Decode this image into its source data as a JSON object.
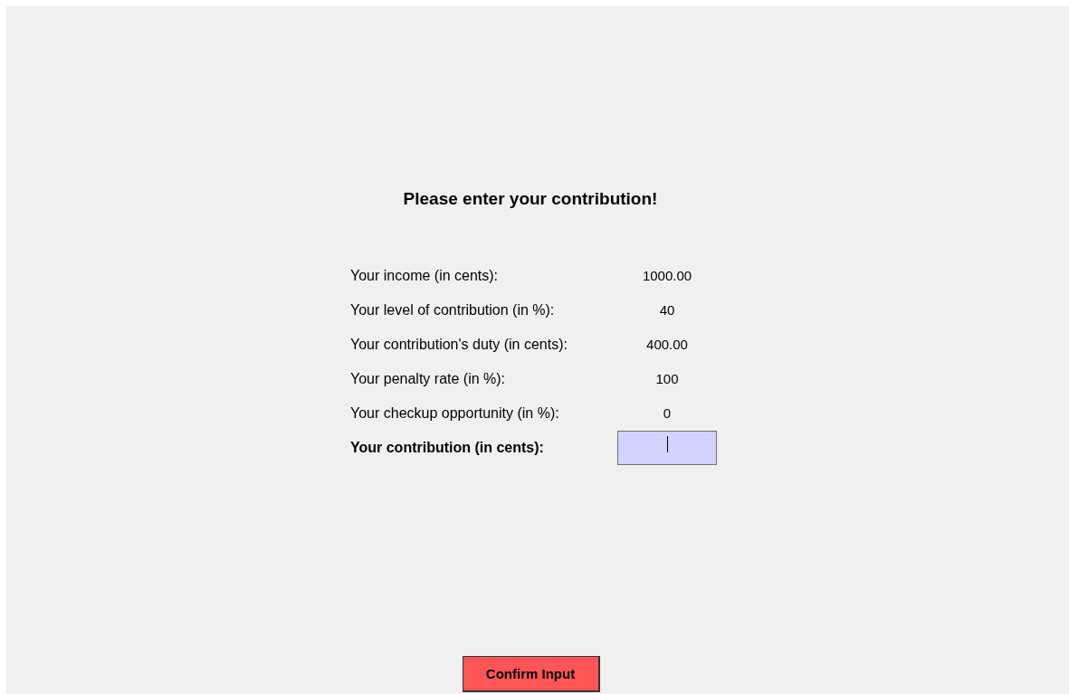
{
  "title": "Please enter your contribution!",
  "rows": [
    {
      "label": "Your income (in cents):",
      "value": "1000.00"
    },
    {
      "label": "Your level of contribution (in %):",
      "value": "40"
    },
    {
      "label": "Your contribution's duty (in cents):",
      "value": "400.00"
    },
    {
      "label": "Your penalty rate (in %):",
      "value": "100"
    },
    {
      "label": "Your checkup opportunity (in %):",
      "value": "0"
    }
  ],
  "input": {
    "label": "Your contribution (in cents):"
  },
  "button": {
    "label": "Confirm Input"
  }
}
